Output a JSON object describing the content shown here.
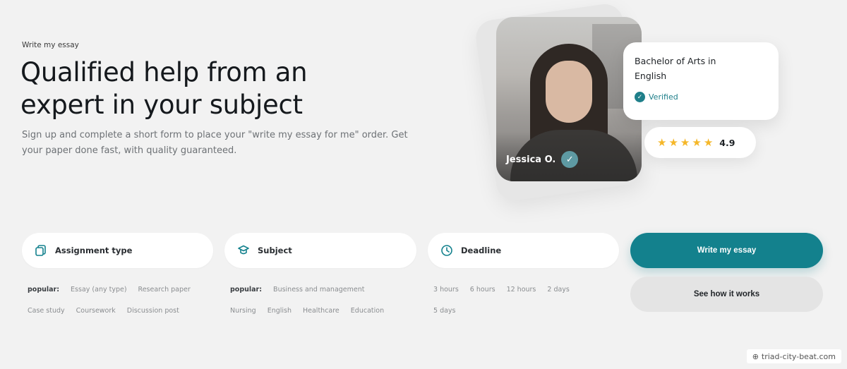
{
  "hero": {
    "eyebrow": "Write my essay",
    "headline_line1": "Qualified help from an",
    "headline_line2": "expert in your subject",
    "subtext": "Sign up and complete a short form to place your \"write my essay for me\" order. Get your paper done fast, with quality guaranteed."
  },
  "expert_card": {
    "name": "Jessica O.",
    "degree": "Bachelor of Arts in English",
    "verified_label": "Verified",
    "rating": "4.9",
    "stars": 5,
    "accent_color": "#1f7f8a",
    "star_color": "#f5b729"
  },
  "form": {
    "assignment": {
      "label": "Assignment type",
      "icon": "document-stack-icon",
      "popular_label": "popular:",
      "options": [
        "Essay (any type)",
        "Research paper",
        "Case study",
        "Coursework",
        "Discussion post"
      ]
    },
    "subject": {
      "label": "Subject",
      "icon": "graduation-cap-icon",
      "popular_label": "popular:",
      "options": [
        "Business and management",
        "Nursing",
        "English",
        "Healthcare",
        "Education"
      ]
    },
    "deadline": {
      "label": "Deadline",
      "icon": "clock-icon",
      "options": [
        "3 hours",
        "6 hours",
        "12 hours",
        "2 days",
        "5 days"
      ]
    },
    "primary_button": "Write my essay",
    "secondary_button": "See how it works",
    "primary_color": "#13818d"
  },
  "watermark": "triad-city-beat.com"
}
